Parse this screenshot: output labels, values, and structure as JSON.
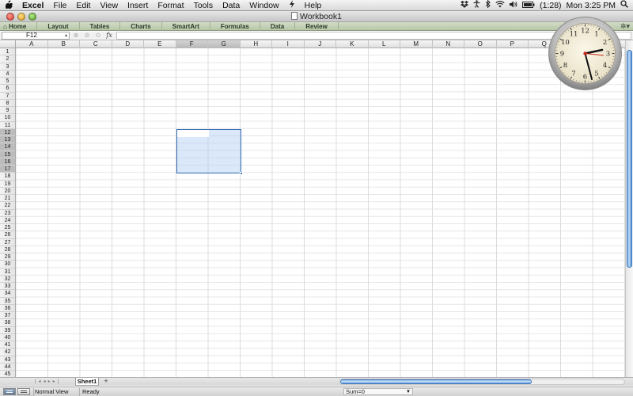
{
  "menubar": {
    "apple": "",
    "items": [
      "Excel",
      "File",
      "Edit",
      "View",
      "Insert",
      "Format",
      "Tools",
      "Data",
      "Window",
      "",
      "Help"
    ],
    "battery": "(1:28)",
    "clock_text": "Mon 3:25 PM"
  },
  "window": {
    "title": "Workbook1"
  },
  "ribbon": {
    "tabs": [
      "Home",
      "Layout",
      "Tables",
      "Charts",
      "SmartArt",
      "Formulas",
      "Data",
      "Review"
    ]
  },
  "formula_bar": {
    "name_box": "F12",
    "fx_label": "fx",
    "content": ""
  },
  "grid": {
    "columns": [
      "A",
      "B",
      "C",
      "D",
      "E",
      "F",
      "G",
      "H",
      "I",
      "J",
      "K",
      "L",
      "M",
      "N",
      "O",
      "P",
      "Q"
    ],
    "rows": [
      "1",
      "2",
      "3",
      "4",
      "5",
      "6",
      "7",
      "8",
      "9",
      "10",
      "11",
      "12",
      "13",
      "14",
      "15",
      "16",
      "17",
      "18",
      "19",
      "20",
      "21",
      "22",
      "23",
      "24",
      "25",
      "26",
      "27",
      "28",
      "29",
      "30",
      "31",
      "32",
      "33",
      "34",
      "35",
      "36",
      "37",
      "38",
      "39",
      "40",
      "41",
      "42",
      "43",
      "44",
      "45"
    ],
    "selection": "F12:G17",
    "active_cell": "F12"
  },
  "sheets": {
    "tabs": [
      "Sheet1"
    ],
    "add_label": "+"
  },
  "status_bar": {
    "view": "Normal View",
    "state": "Ready",
    "sum": "Sum=0"
  },
  "clock_widget": {
    "time": "3:25",
    "numerals": [
      "12",
      "1",
      "2",
      "3",
      "4",
      "5",
      "6",
      "7",
      "8",
      "9",
      "10",
      "11"
    ]
  },
  "colors": {
    "selection_border": "#3a70b5",
    "ribbon_bg": "#c3cfb6",
    "scroll_thumb": "#6fa6e2"
  }
}
